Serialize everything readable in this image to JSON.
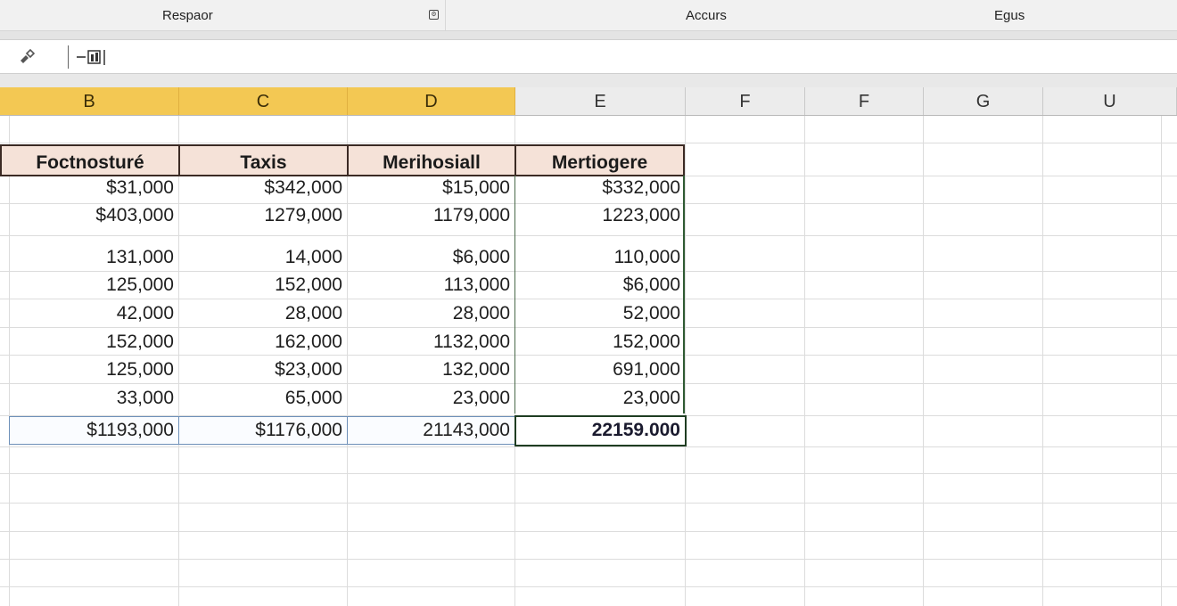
{
  "tabs": [
    "Respaor",
    "Accurs",
    "Egus"
  ],
  "tab_icon": "settings-icon",
  "formula_bar": {
    "tool_icon": "format-painter-icon",
    "fx_icon": "function-icon",
    "fx_label": "−"
  },
  "columns": [
    "B",
    "C",
    "D",
    "E",
    "F",
    "F",
    "G",
    "U"
  ],
  "selected_columns": [
    "B",
    "C",
    "D"
  ],
  "headers": [
    "Foctnosturé",
    "Taxis",
    "Merihosiall",
    "Mertiogere"
  ],
  "rows": [
    [
      "$31,000",
      "$342,000",
      "$15,000",
      "$332,000"
    ],
    [
      "$403,000",
      "1279,000",
      "1179,000",
      "1223,000"
    ],
    [
      "131,000",
      "14,000",
      "$6,000",
      "110,000"
    ],
    [
      "125,000",
      "152,000",
      "113,000",
      "$6,000"
    ],
    [
      "42,000",
      "28,000",
      "28,000",
      "52,000"
    ],
    [
      "152,000",
      "162,000",
      "1132,000",
      "152,000"
    ],
    [
      "125,000",
      "$23,000",
      "132,000",
      "691,000"
    ],
    [
      "33,000",
      "65,000",
      "23,000",
      "23,000"
    ]
  ],
  "totals": [
    "$1193,000",
    "$1176,000",
    "21143,000",
    "22159.000"
  ],
  "colors": {
    "selected_header": "#f3c853",
    "table_header_fill": "#f5e2d8",
    "total_border": "#6d8fb8",
    "active_cell_border": "#1f3d22"
  }
}
